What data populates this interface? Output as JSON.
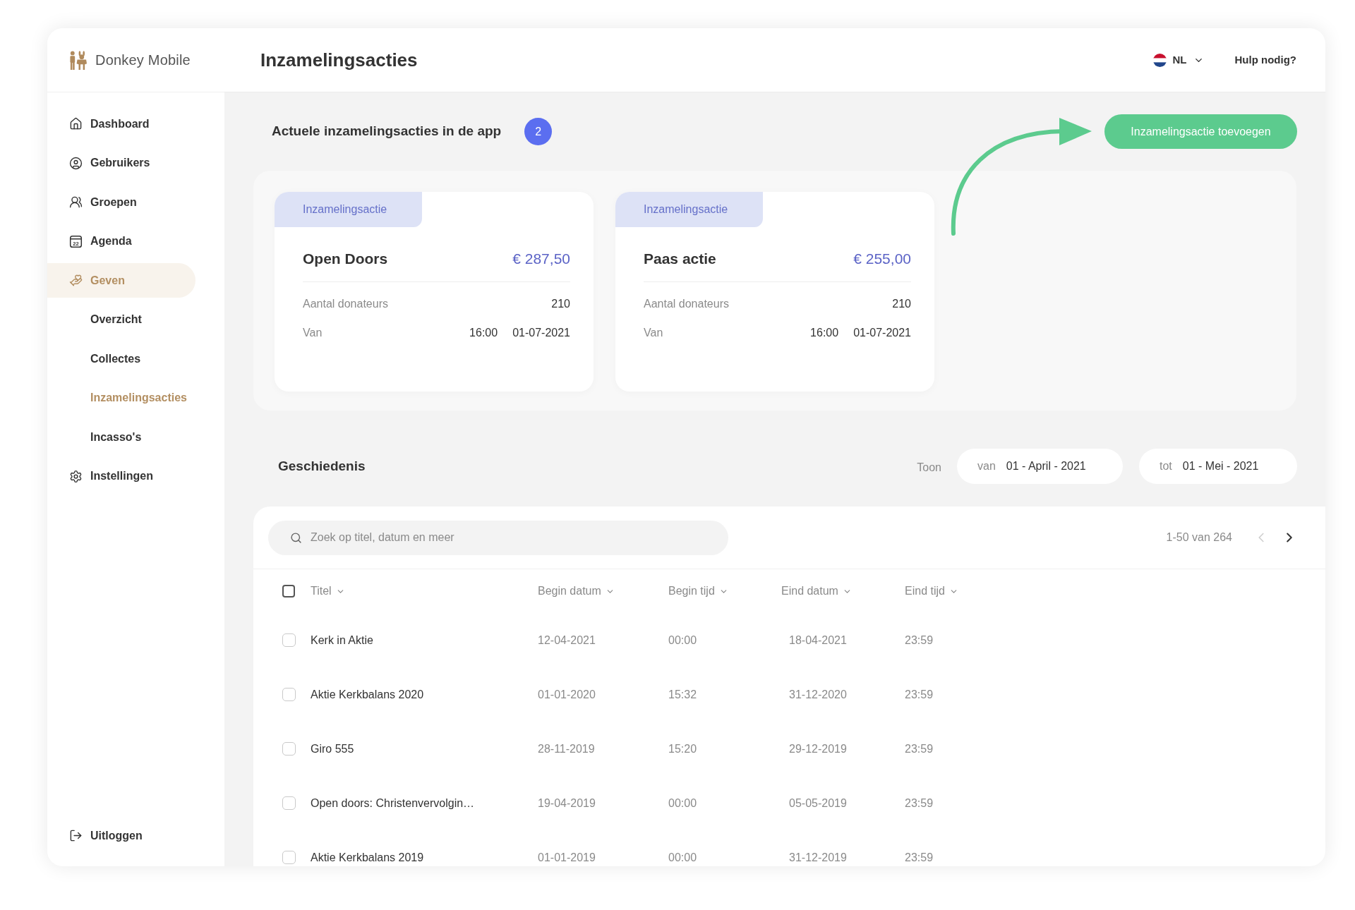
{
  "sidebar": {
    "logo": "Donkey Mobile",
    "items": [
      {
        "label": "Dashboard",
        "selected": false
      },
      {
        "label": "Gebruikers",
        "selected": false
      },
      {
        "label": "Groepen",
        "selected": false
      },
      {
        "label": "Agenda",
        "icon_text": "22",
        "selected": false
      },
      {
        "label": "Geven",
        "selected": true,
        "children": [
          {
            "label": "Overzicht",
            "selected": false
          },
          {
            "label": "Collectes",
            "selected": false
          },
          {
            "label": "Inzamelingsacties",
            "selected": true
          },
          {
            "label": "Incasso's",
            "selected": false
          }
        ]
      },
      {
        "label": "Instellingen",
        "selected": false
      }
    ],
    "logout": "Uitloggen"
  },
  "header": {
    "title": "Inzamelingsacties",
    "language": "NL",
    "help": "Hulp nodig?"
  },
  "active_section": {
    "title": "Actuele inzamelingsacties in de app",
    "count": "2",
    "add_button": "Inzamelingsactie toevoegen",
    "cards": [
      {
        "tag": "Inzamelingsactie",
        "name": "Open Doors",
        "amount": "€ 287,50",
        "donors_label": "Aantal donateurs",
        "donors": "210",
        "from_label": "Van",
        "from_time": "16:00",
        "from_date": "01-07-2021"
      },
      {
        "tag": "Inzamelingsactie",
        "name": "Paas actie",
        "amount": "€ 255,00",
        "donors_label": "Aantal donateurs",
        "donors": "210",
        "from_label": "Van",
        "from_time": "16:00",
        "from_date": "01-07-2021"
      }
    ]
  },
  "history": {
    "title": "Geschiedenis",
    "show_label": "Toon",
    "from": {
      "label": "van",
      "value": "01 - April - 2021"
    },
    "to": {
      "label": "tot",
      "value": "01 - Mei - 2021"
    },
    "search": {
      "placeholder": "Zoek op titel, datum en meer"
    },
    "pagination": {
      "range": "1-50 van 264",
      "prev_disabled": true,
      "next_disabled": false
    },
    "table": {
      "select_all_checked": false,
      "columns": [
        "Titel",
        "Begin datum",
        "Begin tijd",
        "Eind datum",
        "Eind tijd"
      ],
      "rows": [
        {
          "checked": false,
          "cells": [
            "Kerk in Aktie",
            "12-04-2021",
            "00:00",
            "18-04-2021",
            "23:59"
          ]
        },
        {
          "checked": false,
          "cells": [
            "Aktie Kerkbalans 2020",
            "01-01-2020",
            "15:32",
            "31-12-2020",
            "23:59"
          ]
        },
        {
          "checked": false,
          "cells": [
            "Giro 555",
            "28-11-2019",
            "15:20",
            "29-12-2019",
            "23:59"
          ]
        },
        {
          "checked": false,
          "cells": [
            "Open doors: Christenvervolgin…",
            "19-04-2019",
            "00:00",
            "05-05-2019",
            "23:59"
          ]
        },
        {
          "checked": false,
          "cells": [
            "Aktie Kerkbalans 2019",
            "01-01-2019",
            "00:00",
            "31-12-2019",
            "23:59"
          ]
        }
      ]
    }
  }
}
